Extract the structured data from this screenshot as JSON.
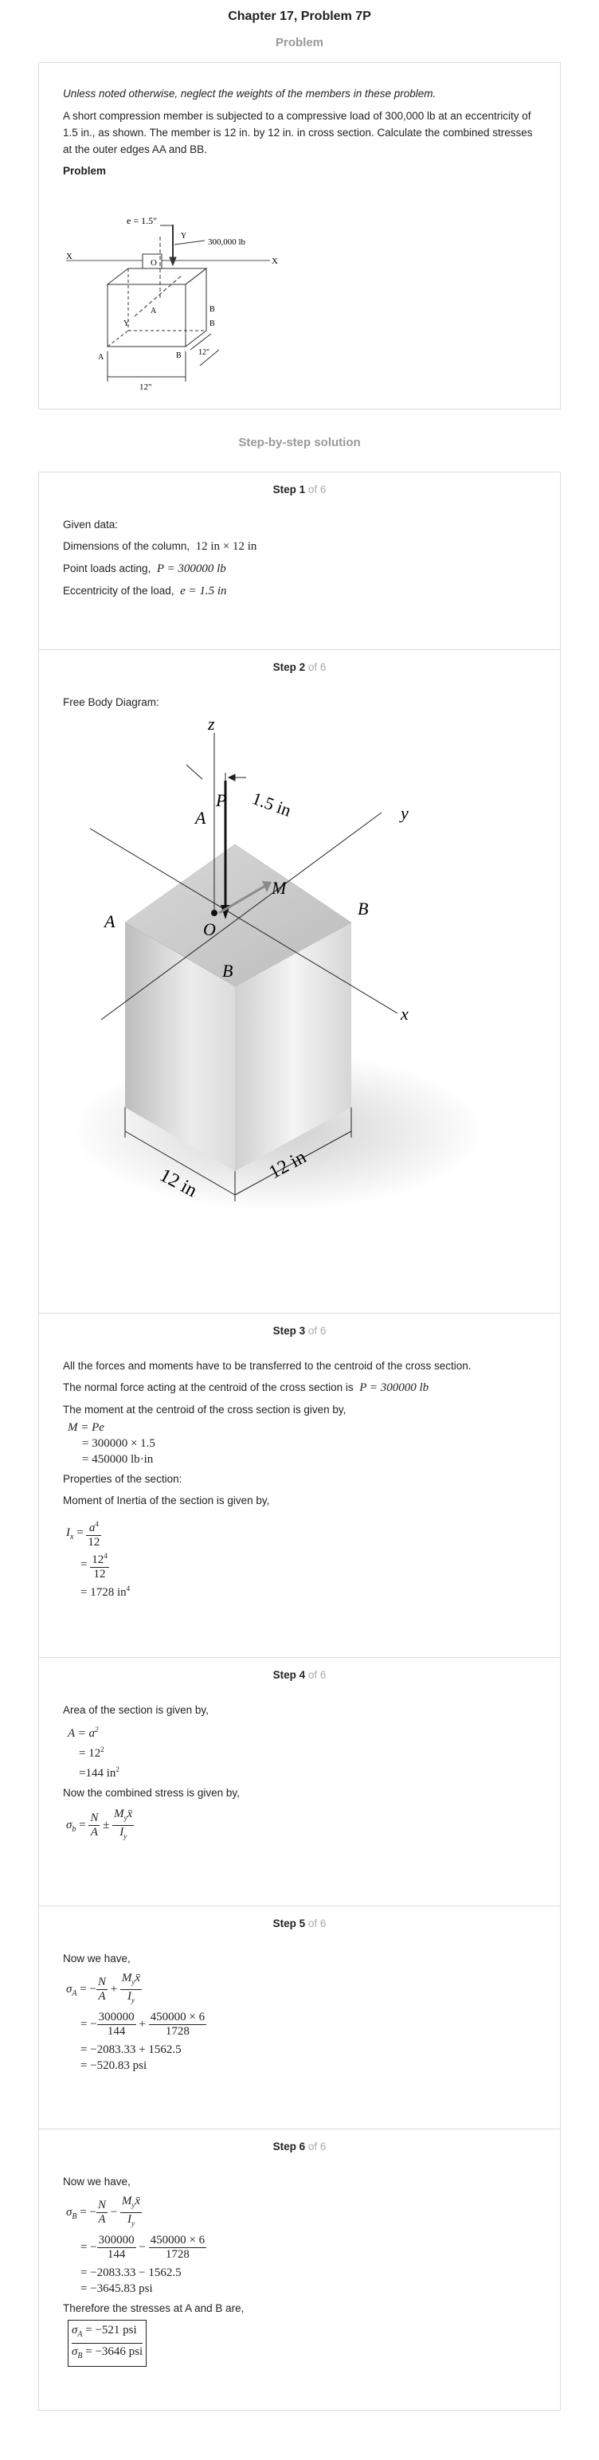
{
  "header": {
    "title": "Chapter 17, Problem 7P",
    "problem_heading": "Problem",
    "solution_heading": "Step-by-step solution"
  },
  "problem": {
    "note": "Unless noted otherwise, neglect the weights of the members in these problem.",
    "text": "A short compression member is subjected to a compressive load of 300,000 lb at an eccentricity of 1.5 in., as shown. The member is 12 in. by 12 in. in cross section. Calculate the combined stresses at the outer edges AA and BB.",
    "label": "Problem",
    "figure": {
      "e_label": "e = 1.5\"",
      "load_label": "300,000 lb",
      "labels": [
        "Y",
        "X",
        "X",
        "O",
        "A",
        "B",
        "Y",
        "A",
        "B",
        "B"
      ],
      "dim_width": "12\"",
      "dim_depth": "12\""
    }
  },
  "steps": [
    {
      "step_word": "Step",
      "number": "1",
      "of_text": "of 6",
      "lines": [
        {
          "text": "Given data:"
        },
        {
          "text": "Dimensions of the column,",
          "math": "12 in × 12 in"
        },
        {
          "text": "Point loads acting,",
          "math": "P = 300000 lb"
        },
        {
          "text": "Eccentricity of the load,",
          "math": "e = 1.5 in"
        }
      ]
    },
    {
      "step_word": "Step",
      "number": "2",
      "of_text": "of 6",
      "lines": [
        {
          "text": "Free Body Diagram:"
        }
      ],
      "figure": {
        "z": "z",
        "y": "y",
        "x": "x",
        "P": "P",
        "M": "M",
        "O": "O",
        "A1": "A",
        "A2": "A",
        "B1": "B",
        "B2": "B",
        "ecc": "1.5 in",
        "dim1": "12 in",
        "dim2": "12 in"
      }
    },
    {
      "step_word": "Step",
      "number": "3",
      "of_text": "of 6",
      "lines": [
        {
          "text": "All the forces and moments have to be transferred to the centroid of the cross section."
        },
        {
          "text": "The normal force acting at the centroid of the cross section is",
          "math": "P = 300000 lb"
        },
        {
          "text": "The moment at the centroid of the cross section is given by,"
        }
      ],
      "moment": [
        "M = Pe",
        "= 300000 × 1.5",
        "= 450000 lb·in"
      ],
      "props": "Properties of the section:",
      "inertia_intro": "Moment of Inertia of the section is given by,",
      "inertia": {
        "lhs": "I",
        "sub": "x",
        "eq": "=",
        "num1": "a",
        "exp1": "4",
        "den": "12",
        "num2": "12",
        "exp2": "4",
        "result": "= 1728 in",
        "result_exp": "4"
      }
    },
    {
      "step_word": "Step",
      "number": "4",
      "of_text": "of 6",
      "area_intro": "Area of the section is given by,",
      "area": [
        "A = a",
        "= 12",
        "=144 in"
      ],
      "area_exp": "2",
      "stress_intro": "Now the combined stress is given by,",
      "stress": {
        "lhs": "σ",
        "sub": "b",
        "eq": "=",
        "N": "N",
        "A": "A",
        "pm": "±",
        "My": "M",
        "My_sub": "y",
        "xbar": "x̄",
        "I": "I",
        "I_sub": "y"
      }
    },
    {
      "step_word": "Step",
      "number": "5",
      "of_text": "of 6",
      "intro": "Now we have,",
      "lhs_sub": "A",
      "row2": {
        "n1": "300000",
        "d1": "144",
        "n2": "450000 × 6",
        "d2": "1728",
        "sign": "+"
      },
      "row3": "= −2083.33 + 1562.5",
      "row4": "= −520.83 psi"
    },
    {
      "step_word": "Step",
      "number": "6",
      "of_text": "of 6",
      "intro": "Now we have,",
      "lhs_sub": "B",
      "row2": {
        "n1": "300000",
        "d1": "144",
        "n2": "450000 × 6",
        "d2": "1728",
        "sign": "−"
      },
      "row3": "= −2083.33 − 1562.5",
      "row4": "= −3645.83 psi",
      "conclusion": "Therefore the stresses at A and B are,",
      "answer_a": "= −521 psi",
      "answer_b": "= −3646 psi"
    }
  ]
}
